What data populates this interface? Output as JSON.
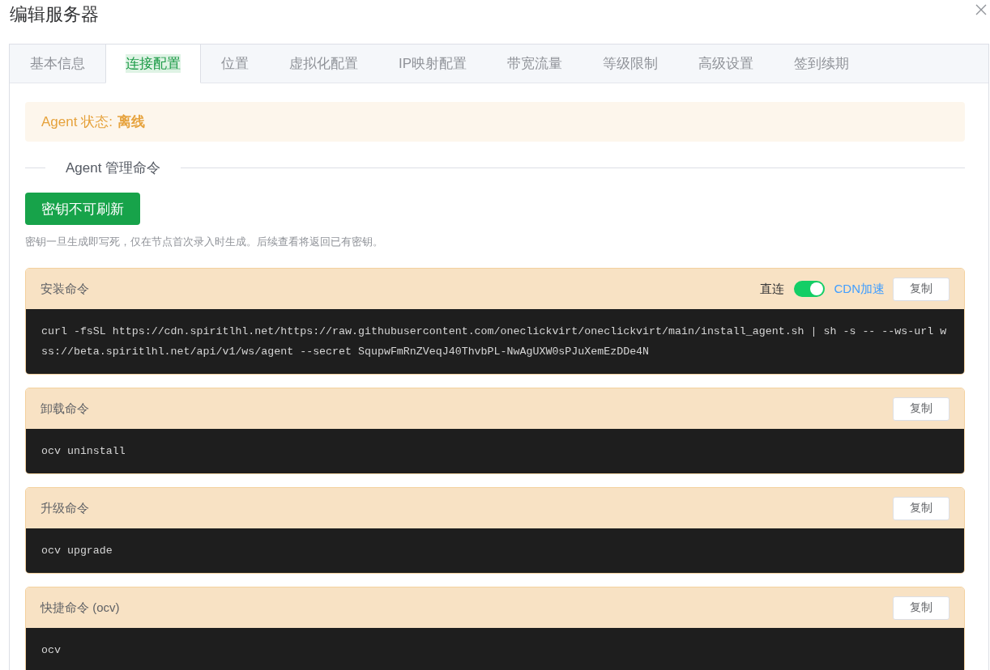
{
  "dialog": {
    "title": "编辑服务器"
  },
  "tabs": [
    {
      "label": "基本信息",
      "selected": false
    },
    {
      "label": "连接配置",
      "selected": true
    },
    {
      "label": "位置",
      "selected": false
    },
    {
      "label": "虚拟化配置",
      "selected": false
    },
    {
      "label": "IP映射配置",
      "selected": false
    },
    {
      "label": "带宽流量",
      "selected": false
    },
    {
      "label": "等级限制",
      "selected": false
    },
    {
      "label": "高级设置",
      "selected": false
    },
    {
      "label": "签到续期",
      "selected": false
    }
  ],
  "agent_status": {
    "label": "Agent 状态:",
    "value": "离线"
  },
  "section_divider": {
    "label": "Agent 管理命令"
  },
  "secret_button": {
    "label": "密钥不可刷新"
  },
  "hint": "密钥一旦生成即写死，仅在节点首次录入时生成。后续查看将返回已有密钥。",
  "commands": [
    {
      "title": "安装命令",
      "source_switch": {
        "inactive_text": "直连",
        "active_text": "CDN加速",
        "on": true
      },
      "copy_label": "复制",
      "code": "curl -fsSL https://cdn.spiritlhl.net/https://raw.githubusercontent.com/oneclickvirt/oneclickvirt/main/install_agent.sh | sh -s -- --ws-url wss://beta.spiritlhl.net/api/v1/ws/agent --secret SqupwFmRnZVeqJ40ThvbPL-NwAgUXW0sPJuXemEzDDe4N"
    },
    {
      "title": "卸载命令",
      "copy_label": "复制",
      "code": "ocv uninstall"
    },
    {
      "title": "升级命令",
      "copy_label": "复制",
      "code": "ocv upgrade"
    },
    {
      "title": "快捷命令 (ocv)",
      "copy_label": "复制",
      "code": "ocv"
    }
  ]
}
